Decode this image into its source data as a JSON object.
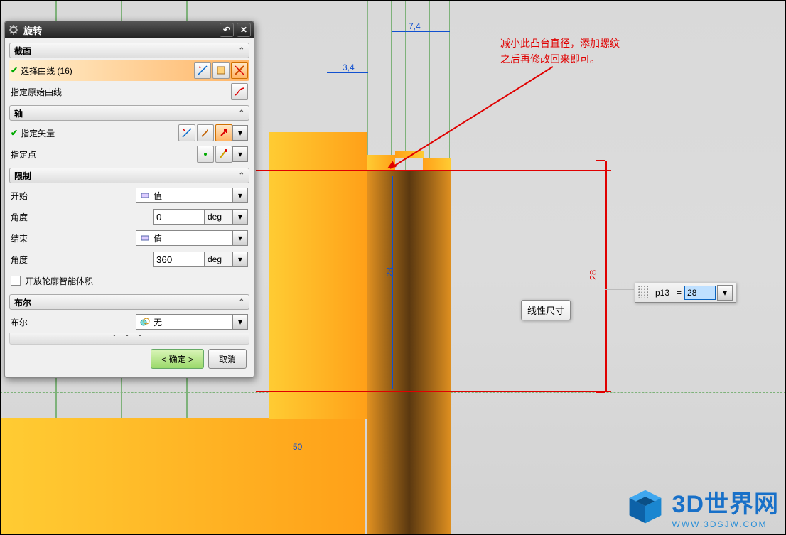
{
  "dialog": {
    "title": "旋转",
    "section_curves": "截面",
    "select_curve": "选择曲线 (16)",
    "orig_curve": "指定原始曲线",
    "section_axis": "轴",
    "spec_vector": "指定矢量",
    "spec_point": "指定点",
    "section_limit": "限制",
    "start_label": "开始",
    "start_sel": "值",
    "start_ang_label": "角度",
    "start_ang_val": "0",
    "start_ang_unit": "deg",
    "end_label": "结束",
    "end_sel": "值",
    "end_ang_label": "角度",
    "end_ang_val": "360",
    "end_ang_unit": "deg",
    "smart_vol": "开放轮廓智能体积",
    "section_bool": "布尔",
    "bool_label": "布尔",
    "bool_sel": "无",
    "expand": "ˇ ˇ ˇ",
    "ok": "< 确定 >",
    "cancel": "取消"
  },
  "dims": {
    "d74": "7,4",
    "d34": "3,4",
    "d50": "50",
    "d28_rot": "28",
    "d28_center": "28"
  },
  "annotation": {
    "line1": "减小此凸台直径，添加螺纹",
    "line2": "之后再修改回来即可。"
  },
  "tooltip": "线性尺寸",
  "pbox": {
    "label": "p13",
    "eq": "=",
    "value": "28"
  },
  "logo": {
    "title": "3D世界网",
    "sub": "WWW.3DSJW.COM"
  }
}
